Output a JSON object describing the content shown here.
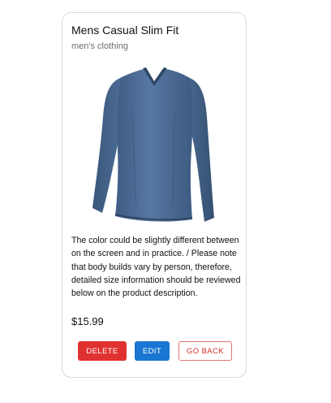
{
  "product": {
    "title": "Mens Casual Slim Fit",
    "category": "men's clothing",
    "image_subject": "long-sleeve blue v-neck t-shirt",
    "description": "The color could be slightly different between on the screen and in practice. / Please note that body builds vary by person, therefore, detailed size information should be reviewed below on the product description.",
    "price": "$15.99"
  },
  "actions": {
    "delete_label": "DELETE",
    "edit_label": "EDIT",
    "back_label": "GO BACK"
  },
  "colors": {
    "delete": "#e03131",
    "edit": "#1976d2",
    "back_border": "#e57373",
    "shirt": "#4a6a93"
  }
}
